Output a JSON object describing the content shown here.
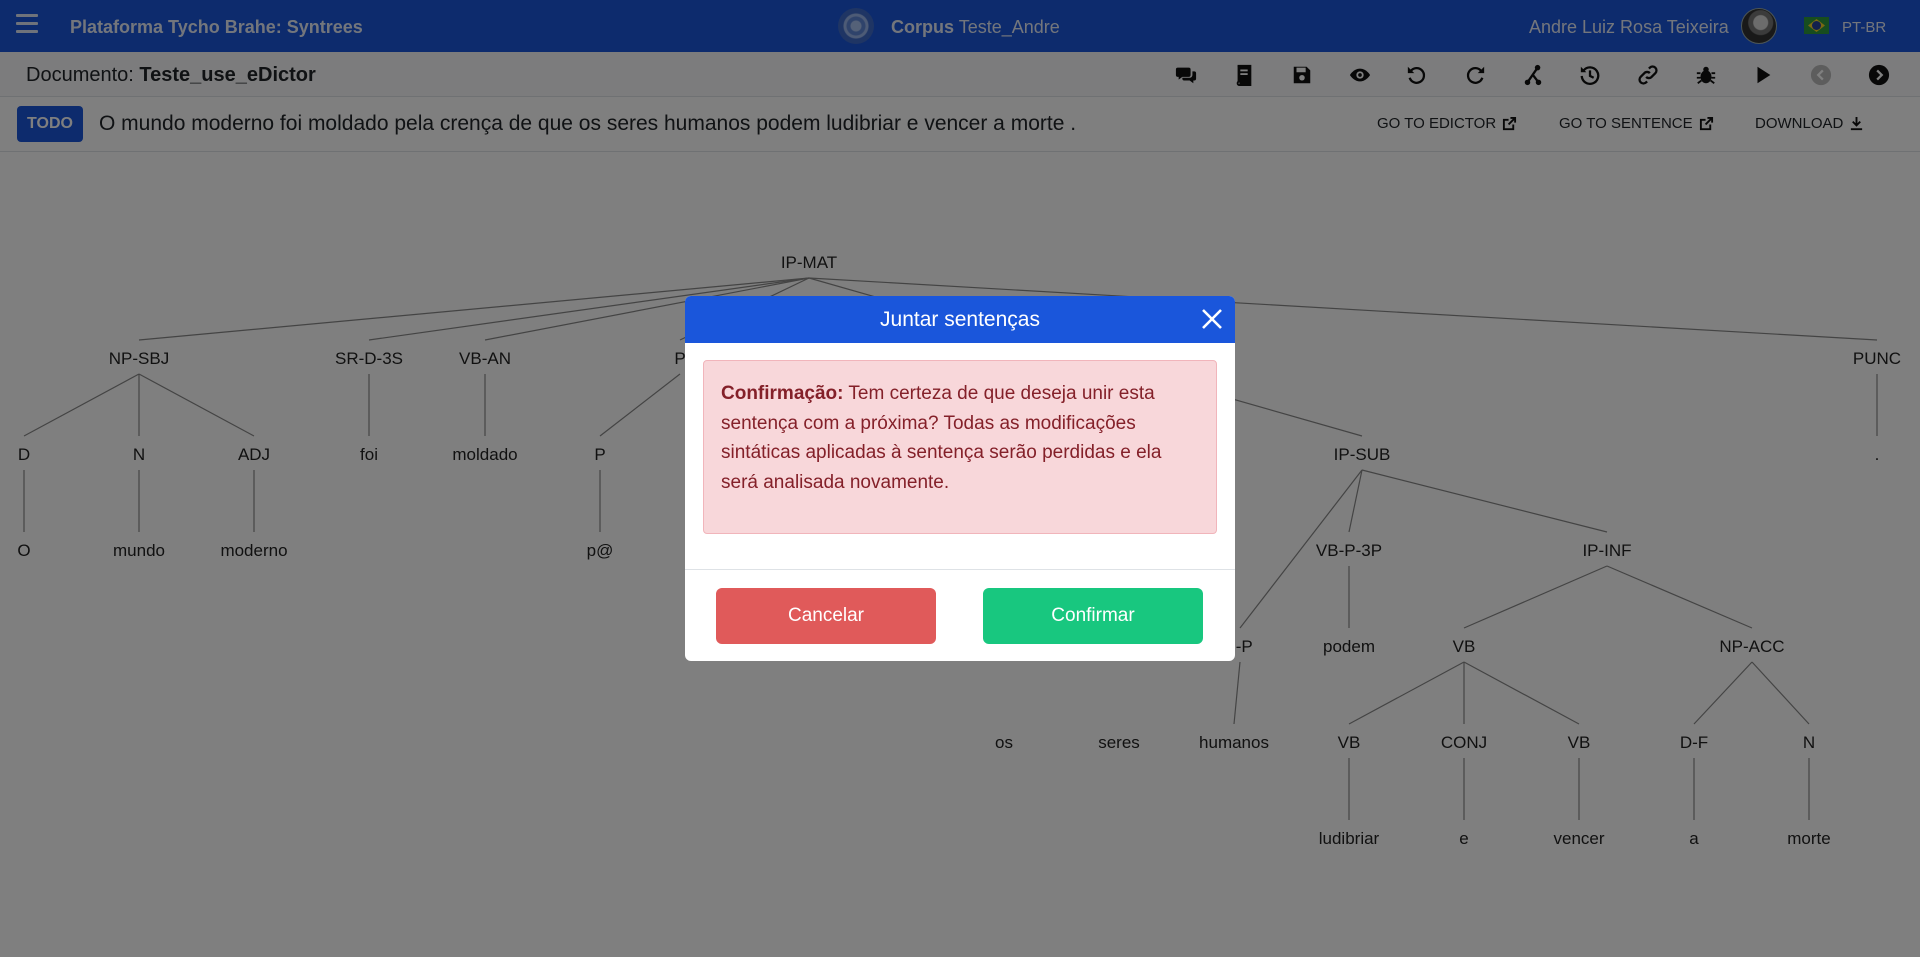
{
  "navbar": {
    "brand": "Plataforma Tycho Brahe: Syntrees",
    "corpus_label": "Corpus",
    "corpus_name": "Teste_Andre",
    "user_name": "Andre Luiz Rosa Teixeira",
    "language": "PT-BR"
  },
  "docbar": {
    "label": "Documento:",
    "name": "Teste_use_eDictor",
    "tools": [
      "comments-icon",
      "book-icon",
      "save-icon",
      "eye-icon",
      "undo-icon",
      "redo-icon",
      "tree-branch-icon",
      "history-icon",
      "link-icon",
      "bug-icon",
      "play-icon",
      "previous-icon",
      "next-icon"
    ]
  },
  "sentbar": {
    "status": "TODO",
    "sentence": "O mundo moderno foi moldado pela crença de que os seres humanos podem ludibriar e vencer a morte .",
    "go_to_edictor": "GO TO EDICTOR",
    "go_to_sentence": "GO TO SENTENCE",
    "download": "DOWNLOAD"
  },
  "tree": {
    "nodes": [
      {
        "id": "ipmat",
        "label": "IP-MAT"
      },
      {
        "id": "npsbj",
        "label": "NP-SBJ"
      },
      {
        "id": "srd3s",
        "label": "SR-D-3S"
      },
      {
        "id": "vban",
        "label": "VB-AN"
      },
      {
        "id": "pp",
        "label": "P"
      },
      {
        "id": "punc",
        "label": "PUNC"
      },
      {
        "id": "d",
        "label": "D"
      },
      {
        "id": "n",
        "label": "N"
      },
      {
        "id": "adj",
        "label": "ADJ"
      },
      {
        "id": "foi",
        "label": "foi"
      },
      {
        "id": "moldado",
        "label": "moldado"
      },
      {
        "id": "p",
        "label": "P"
      },
      {
        "id": "ipsub",
        "label": "IP-SUB"
      },
      {
        "id": "period",
        "label": "."
      },
      {
        "id": "o",
        "label": "O"
      },
      {
        "id": "mundo",
        "label": "mundo"
      },
      {
        "id": "moderno",
        "label": "moderno"
      },
      {
        "id": "pat",
        "label": "p@"
      },
      {
        "id": "vbp3p",
        "label": "VB-P-3P"
      },
      {
        "id": "ipinf",
        "label": "IP-INF"
      },
      {
        "id": "adjp",
        "label": "J-P"
      },
      {
        "id": "podem",
        "label": "podem"
      },
      {
        "id": "vb",
        "label": "VB"
      },
      {
        "id": "npacc",
        "label": "NP-ACC"
      },
      {
        "id": "os",
        "label": "os"
      },
      {
        "id": "seres",
        "label": "seres"
      },
      {
        "id": "humanos",
        "label": "humanos"
      },
      {
        "id": "vb1",
        "label": "VB"
      },
      {
        "id": "conj",
        "label": "CONJ"
      },
      {
        "id": "vb2",
        "label": "VB"
      },
      {
        "id": "df",
        "label": "D-F"
      },
      {
        "id": "n2",
        "label": "N"
      },
      {
        "id": "ludibriar",
        "label": "ludibriar"
      },
      {
        "id": "e",
        "label": "e"
      },
      {
        "id": "vencer",
        "label": "vencer"
      },
      {
        "id": "a",
        "label": "a"
      },
      {
        "id": "morte",
        "label": "morte"
      }
    ]
  },
  "modal": {
    "title": "Juntar sentenças",
    "alert_strong": "Confirmação:",
    "alert_text": "Tem certeza de que deseja unir esta sentença com a próxima? Todas as modificações sintáticas aplicadas à sentença serão perdidas e ela será analisada novamente.",
    "cancel_label": "Cancelar",
    "confirm_label": "Confirmar"
  },
  "colors": {
    "primary": "#1a56db",
    "cancel": "#e05a5a",
    "confirm": "#18c77f",
    "alert_bg": "#f8d7da",
    "alert_text": "#842029"
  }
}
